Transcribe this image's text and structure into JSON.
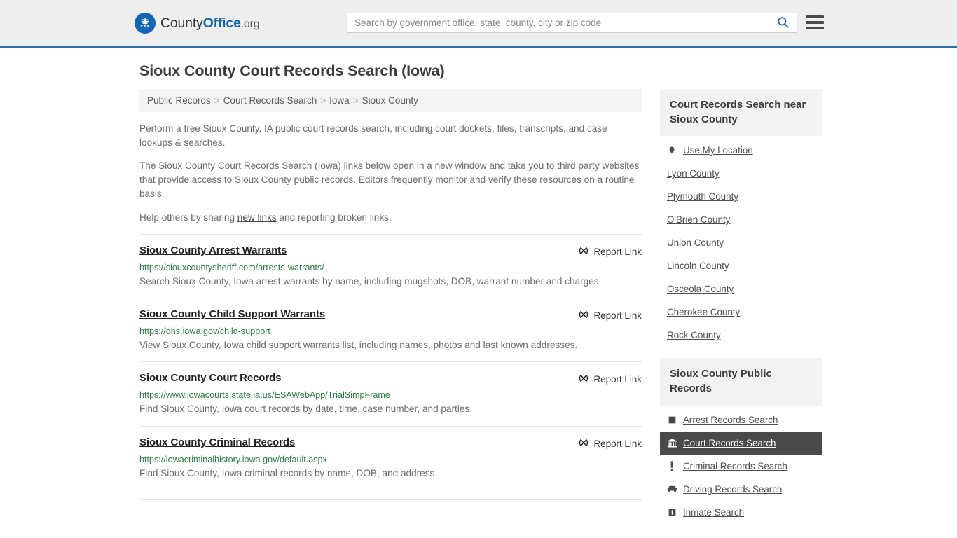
{
  "header": {
    "brand": {
      "part1": "County",
      "part2": "Office",
      "part3": ".org",
      "icon": "eagle-seal-icon"
    },
    "search": {
      "placeholder": "Search by government office, state, county, city or zip code",
      "value": ""
    },
    "search_icon": "search-icon",
    "menu_icon": "hamburger-menu-icon"
  },
  "page": {
    "title": "Sioux County Court Records Search (Iowa)"
  },
  "breadcrumb": {
    "items": [
      "Public Records",
      "Court Records Search",
      "Iowa",
      "Sioux County"
    ],
    "separator": ">"
  },
  "intro": {
    "p1": "Perform a free Sioux County, IA public court records search, including court dockets, files, transcripts, and case lookups & searches.",
    "p2": "The Sioux County Court Records Search (Iowa) links below open in a new window and take you to third party websites that provide access to Sioux County public records. Editors frequently monitor and verify these resources on a routine basis.",
    "p3_before": "Help others by sharing ",
    "p3_link": "new links",
    "p3_after": " and reporting broken links."
  },
  "report_link_label": "Report Link",
  "report_link_icon": "broken-link-icon",
  "listings": [
    {
      "title": "Sioux County Arrest Warrants",
      "url": "https://siouxcountysheriff.com/arrests-warrants/",
      "description": "Search Sioux County, Iowa arrest warrants by name, including mugshots, DOB, warrant number and charges."
    },
    {
      "title": "Sioux County Child Support Warrants",
      "url": "https://dhs.iowa.gov/child-support",
      "description": "View Sioux County, Iowa child support warrants list, including names, photos and last known addresses."
    },
    {
      "title": "Sioux County Court Records",
      "url": "https://www.iowacourts.state.ia.us/ESAWebApp/TrialSimpFrame",
      "description": "Find Sioux County, Iowa court records by date, time, case number, and parties."
    },
    {
      "title": "Sioux County Criminal Records",
      "url": "https://iowacriminalhistory.iowa.gov/default.aspx",
      "description": "Find Sioux County, Iowa criminal records by name, DOB, and address."
    }
  ],
  "sidebar": {
    "near_box": {
      "heading": "Court Records Search near Sioux County",
      "items": [
        {
          "label": "Use My Location",
          "icon": "map-pin-icon",
          "active": false
        },
        {
          "label": "Lyon County",
          "icon": "",
          "active": false
        },
        {
          "label": "Plymouth County",
          "icon": "",
          "active": false
        },
        {
          "label": "O'Brien County",
          "icon": "",
          "active": false
        },
        {
          "label": "Union County",
          "icon": "",
          "active": false
        },
        {
          "label": "Lincoln County",
          "icon": "",
          "active": false
        },
        {
          "label": "Osceola County",
          "icon": "",
          "active": false
        },
        {
          "label": "Cherokee County",
          "icon": "",
          "active": false
        },
        {
          "label": "Rock County",
          "icon": "",
          "active": false
        }
      ]
    },
    "public_records_box": {
      "heading": "Sioux County Public Records",
      "items": [
        {
          "label": "Arrest Records Search",
          "icon": "square-icon",
          "active": false
        },
        {
          "label": "Court Records Search",
          "icon": "courthouse-icon",
          "active": true
        },
        {
          "label": "Criminal Records Search",
          "icon": "exclamation-icon",
          "active": false
        },
        {
          "label": "Driving Records Search",
          "icon": "car-icon",
          "active": false
        },
        {
          "label": "Inmate Search",
          "icon": "inmate-icon",
          "active": false
        }
      ]
    }
  },
  "colors": {
    "header_bg": "#eeeeee",
    "header_border": "#2e6da4",
    "brand_blue": "#1565b0",
    "url_green": "#2b7a42",
    "active_bg": "#4a4a4a"
  }
}
